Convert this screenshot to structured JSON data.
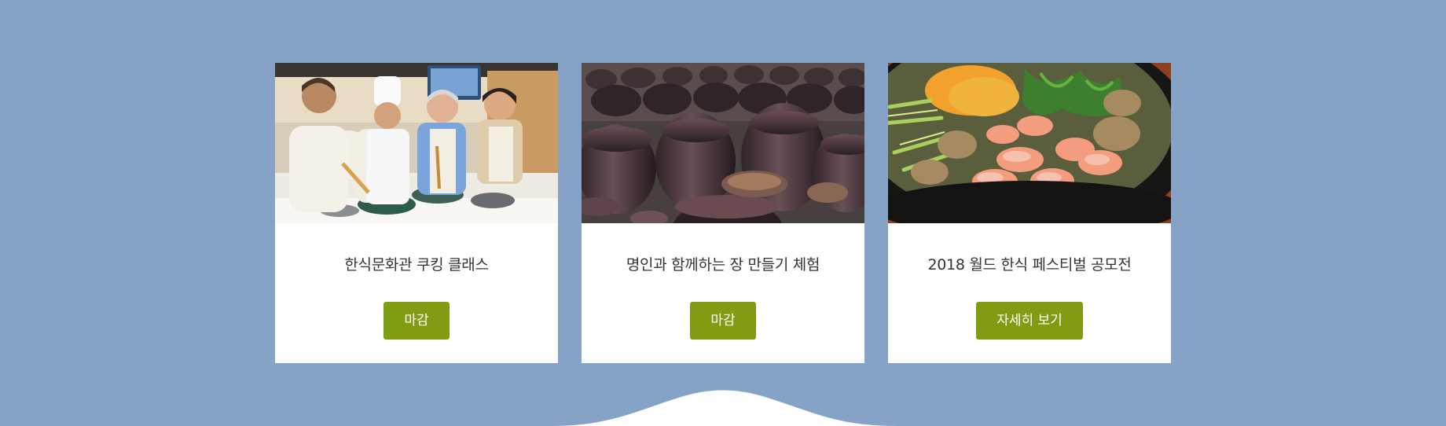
{
  "colors": {
    "page_background": "#87a2c7",
    "card_background": "#ffffff",
    "button_background": "#7f9c13",
    "button_text": "#ffffff",
    "title_text": "#333333"
  },
  "cards": [
    {
      "image": "cooking-class-photo",
      "title": "한식문화관 쿠킹 클래스",
      "button_label": "마감"
    },
    {
      "image": "jang-jars-photo",
      "title": "명인과 함께하는 장 만들기 체험",
      "button_label": "마감"
    },
    {
      "image": "bibimbap-photo",
      "title": "2018 월드 한식 페스티벌 공모전",
      "button_label": "자세히 보기"
    }
  ]
}
